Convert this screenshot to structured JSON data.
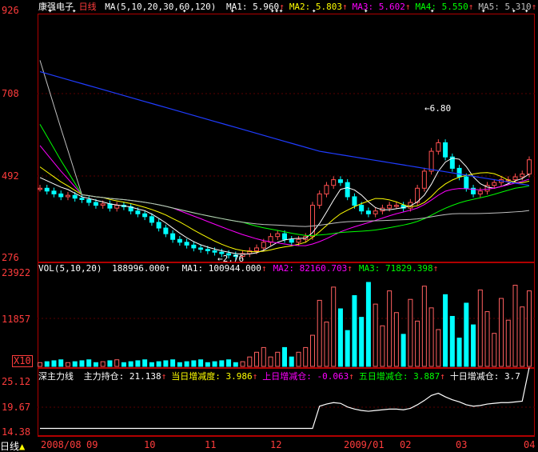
{
  "stock": {
    "name": "康强电子",
    "period": "日线"
  },
  "price_panel": {
    "ma_params": "MA(5,10,20,30,60,120)",
    "legend": [
      {
        "label": "MA1:",
        "value": "5.960",
        "arrow": "↑",
        "color": "#ffffff"
      },
      {
        "label": "MA2:",
        "value": "5.803",
        "arrow": "↑",
        "color": "#ffff00"
      },
      {
        "label": "MA3:",
        "value": "5.602",
        "arrow": "↑",
        "color": "#ff00ff"
      },
      {
        "label": "MA4:",
        "value": "5.550",
        "arrow": "↑",
        "color": "#00ff00"
      },
      {
        "label": "MA5:",
        "value": "5.310",
        "arrow": "↑",
        "color": "#c0c0c0"
      },
      {
        "label": "MA6",
        "value": "",
        "arrow": "",
        "color": "#3050ff"
      }
    ],
    "y_labels": [
      "926",
      "708",
      "492",
      "276"
    ],
    "high_marker": "6.80",
    "low_marker": "2.76"
  },
  "volume_panel": {
    "title": "VOL(5,10,20)",
    "current": "188996.000↑",
    "legend": [
      {
        "label": "MA1:",
        "value": "100944.000",
        "arrow": "↑",
        "color": "#ffffff"
      },
      {
        "label": "MA2:",
        "value": "82160.703",
        "arrow": "↑",
        "color": "#ff00ff"
      },
      {
        "label": "MA3:",
        "value": "71829.398",
        "arrow": "↑",
        "color": "#00ff00"
      }
    ],
    "y_labels": [
      "23922",
      "11857"
    ],
    "unit_label": "X10"
  },
  "indicator_panel": {
    "title": "深主力线",
    "legend": [
      {
        "label": "主力持仓:",
        "value": "21.138",
        "arrow": "↑",
        "color": "#ffffff"
      },
      {
        "label": "当日增减度:",
        "value": "3.986",
        "arrow": "↑",
        "color": "#ffff00"
      },
      {
        "label": "上日增减仓:",
        "value": "-0.063",
        "arrow": "↑",
        "color": "#ff00ff"
      },
      {
        "label": "五日增减仓:",
        "value": "3.887",
        "arrow": "↑",
        "color": "#00ff00"
      },
      {
        "label": "十日增减仓:",
        "value": "3.7",
        "arrow": "",
        "color": "#ffffff"
      }
    ],
    "y_labels": [
      "25.12",
      "19.67",
      "14.38"
    ]
  },
  "x_axis": {
    "labels": [
      "2008/08",
      "09",
      "10",
      "11",
      "12",
      "2009/01",
      "02",
      "03",
      "04"
    ]
  },
  "chart_data": {
    "type": "candlestick",
    "ylim": [
      2.76,
      9.26
    ],
    "price_close": [
      5.2,
      5.1,
      5.0,
      4.9,
      4.95,
      4.85,
      4.8,
      4.7,
      4.6,
      4.65,
      4.5,
      4.6,
      4.55,
      4.4,
      4.3,
      4.2,
      4.0,
      3.8,
      3.6,
      3.4,
      3.3,
      3.2,
      3.1,
      3.05,
      3.0,
      2.95,
      2.9,
      2.85,
      2.8,
      2.9,
      3.0,
      3.1,
      3.3,
      3.5,
      3.6,
      3.4,
      3.3,
      3.4,
      3.5,
      4.6,
      5.0,
      5.3,
      5.5,
      5.4,
      4.9,
      4.6,
      4.4,
      4.3,
      4.4,
      4.5,
      4.6,
      4.6,
      4.5,
      4.7,
      5.2,
      5.8,
      6.5,
      6.8,
      6.3,
      5.9,
      5.6,
      5.2,
      5.0,
      5.1,
      5.3,
      5.4,
      5.5,
      5.5,
      5.6,
      5.7,
      6.2
    ],
    "markers": [
      {
        "label": "6.80",
        "type": "high"
      },
      {
        "label": "2.76",
        "type": "low"
      }
    ]
  }
}
